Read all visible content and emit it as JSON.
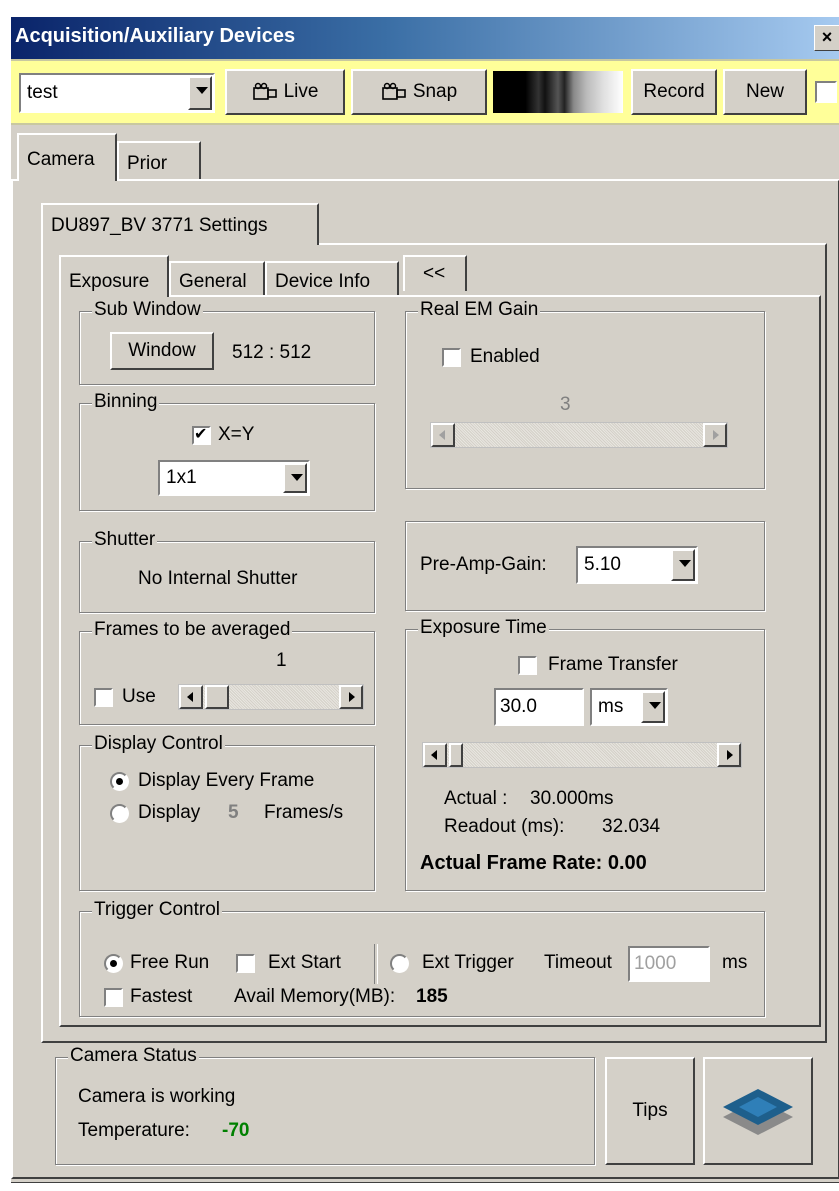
{
  "window": {
    "title": "Acquisition/Auxiliary Devices",
    "close": "×"
  },
  "toolbar": {
    "config_value": "test",
    "live_label": "Live",
    "snap_label": "Snap",
    "record_label": "Record",
    "new_label": "New"
  },
  "tabs": {
    "camera": "Camera",
    "prior": "Prior"
  },
  "settings_tab": "DU897_BV 3771 Settings",
  "inner_tabs": {
    "exposure": "Exposure",
    "general": "General",
    "device_info": "Device Info",
    "collapse": "<<"
  },
  "sub_window": {
    "legend": "Sub Window",
    "button": "Window",
    "value": "512 : 512"
  },
  "binning": {
    "legend": "Binning",
    "xy_label": "X=Y",
    "xy_checked": true,
    "value": "1x1"
  },
  "shutter": {
    "legend": "Shutter",
    "text": "No Internal Shutter"
  },
  "frames_avg": {
    "legend": "Frames to be averaged",
    "value": "1",
    "use_label": "Use"
  },
  "display_control": {
    "legend": "Display Control",
    "every_label": "Display Every Frame",
    "display_label": "Display",
    "fps_value": "5",
    "fps_unit": "Frames/s"
  },
  "real_em_gain": {
    "legend": "Real EM Gain",
    "enabled_label": "Enabled",
    "value": "3"
  },
  "pre_amp": {
    "label": "Pre-Amp-Gain:",
    "value": "5.10"
  },
  "exposure_time": {
    "legend": "Exposure Time",
    "frame_transfer_label": "Frame Transfer",
    "value": "30.0",
    "unit": "ms",
    "actual_label": "Actual :",
    "actual_value": "30.000ms",
    "readout_label": "Readout (ms):",
    "readout_value": "32.034",
    "frame_rate": "Actual Frame Rate: 0.00"
  },
  "trigger": {
    "legend": "Trigger Control",
    "free_run": "Free Run",
    "ext_start": "Ext Start",
    "ext_trigger": "Ext Trigger",
    "timeout_label": "Timeout",
    "timeout_value": "1000",
    "timeout_unit": "ms",
    "fastest": "Fastest",
    "avail_label": "Avail Memory(MB):",
    "avail_value": "185"
  },
  "camera_status": {
    "legend": "Camera Status",
    "status": "Camera is working",
    "temp_label": "Temperature:",
    "temp_value": "-70"
  },
  "buttons": {
    "tips": "Tips"
  },
  "colors": {
    "accent_title": "#0a246a",
    "toolbar_bg": "#ffff99",
    "temperature": "#008000"
  },
  "icons": {
    "live": "camera-icon",
    "snap": "camera-icon",
    "logo": "layers-logo-icon"
  }
}
